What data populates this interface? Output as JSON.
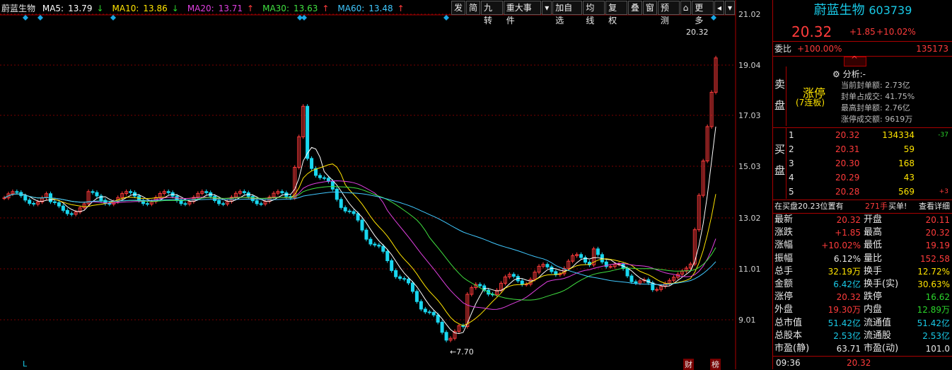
{
  "ma_legend": {
    "name": "蔚蓝生物",
    "items": [
      {
        "label": "MA5:",
        "value": "13.79",
        "arrow": "↓",
        "color": "#ffffff"
      },
      {
        "label": "MA10:",
        "value": "13.86",
        "arrow": "↓",
        "color": "#ffe400"
      },
      {
        "label": "MA20:",
        "value": "13.71",
        "arrow": "↑",
        "color": "#e040e0"
      },
      {
        "label": "MA30:",
        "value": "13.63",
        "arrow": "↑",
        "color": "#40e040"
      },
      {
        "label": "MA60:",
        "value": "13.48",
        "arrow": "↑",
        "color": "#40c8ff"
      }
    ]
  },
  "toolbar": [
    "发",
    "简",
    "九转",
    "重大事件",
    "▾",
    "加自选",
    "均线",
    "复权",
    "叠",
    "窗",
    "预测",
    "⌂",
    "更多",
    "◂",
    "▾"
  ],
  "y_axis": [
    "21.02",
    "19.04",
    "17.03",
    "15.03",
    "13.02",
    "11.01",
    "9.01"
  ],
  "annotations": {
    "high": "20.32",
    "low": "7.70",
    "left_marker": "L",
    "bottom_tag1": "财",
    "bottom_tag2": "榜"
  },
  "stock": {
    "name": "蔚蓝生物",
    "code": "603739",
    "price": "20.32",
    "change": "+1.85",
    "pct": "+10.02%"
  },
  "weibi": {
    "label": "委比",
    "pct": "+100.00%",
    "diff": "135173"
  },
  "sell": {
    "label1": "卖",
    "label2": "盘",
    "status": "涨停",
    "status_sub": "(7连板)",
    "analysis_title": "分析:-",
    "lines": [
      "当前封单额: 2.73亿",
      "封单占成交: 41.75%",
      "最高封单额: 2.76亿",
      "涨停成交额: 9619万"
    ]
  },
  "buy": {
    "label1": "买",
    "label2": "盘",
    "rows": [
      {
        "lvl": "1",
        "price": "20.32",
        "vol": "134334",
        "chg": "-37"
      },
      {
        "lvl": "2",
        "price": "20.31",
        "vol": "59",
        "chg": ""
      },
      {
        "lvl": "3",
        "price": "20.30",
        "vol": "168",
        "chg": ""
      },
      {
        "lvl": "4",
        "price": "20.29",
        "vol": "43",
        "chg": ""
      },
      {
        "lvl": "5",
        "price": "20.28",
        "vol": "569",
        "chg": "+3"
      }
    ]
  },
  "notice": {
    "text": "在买盘20.23位置有",
    "qty": "271手",
    "suffix": "买单!",
    "link": "查看详细"
  },
  "stats": [
    {
      "l1": "最新",
      "v1": "20.32",
      "c1": "#ff3b3b",
      "l2": "开盘",
      "v2": "20.11",
      "c2": "#ff3b3b"
    },
    {
      "l1": "涨跌",
      "v1": "+1.85",
      "c1": "#ff3b3b",
      "l2": "最高",
      "v2": "20.32",
      "c2": "#ff3b3b"
    },
    {
      "l1": "涨幅",
      "v1": "+10.02%",
      "c1": "#ff3b3b",
      "l2": "最低",
      "v2": "19.19",
      "c2": "#ff3b3b"
    },
    {
      "l1": "振幅",
      "v1": "6.12%",
      "c1": "#e8e8e8",
      "l2": "量比",
      "v2": "152.58",
      "c2": "#ff3b3b"
    },
    {
      "l1": "总手",
      "v1": "32.19万",
      "c1": "#ffe400",
      "l2": "换手",
      "v2": "12.72%",
      "c2": "#ffe400"
    },
    {
      "l1": "金额",
      "v1": "6.42亿",
      "c1": "#19c9e6",
      "l2": "换手(实)",
      "v2": "30.63%",
      "c2": "#ffe400"
    },
    {
      "l1": "涨停",
      "v1": "20.32",
      "c1": "#ff3b3b",
      "l2": "跌停",
      "v2": "16.62",
      "c2": "#2bd62b"
    },
    {
      "l1": "外盘",
      "v1": "19.30万",
      "c1": "#ff3b3b",
      "l2": "内盘",
      "v2": "12.89万",
      "c2": "#2bd62b"
    },
    {
      "l1": "总市值",
      "v1": "51.42亿",
      "c1": "#19c9e6",
      "l2": "流通值",
      "v2": "51.42亿",
      "c2": "#19c9e6"
    },
    {
      "l1": "总股本",
      "v1": "2.53亿",
      "c1": "#19c9e6",
      "l2": "流通股",
      "v2": "2.53亿",
      "c2": "#19c9e6"
    },
    {
      "l1": "市盈(静)",
      "v1": "63.71",
      "c1": "#e8e8e8",
      "l2": "市盈(动)",
      "v2": "101.0",
      "c2": "#e8e8e8"
    }
  ],
  "bottom": {
    "time": "09:36",
    "price": "20.32"
  }
}
